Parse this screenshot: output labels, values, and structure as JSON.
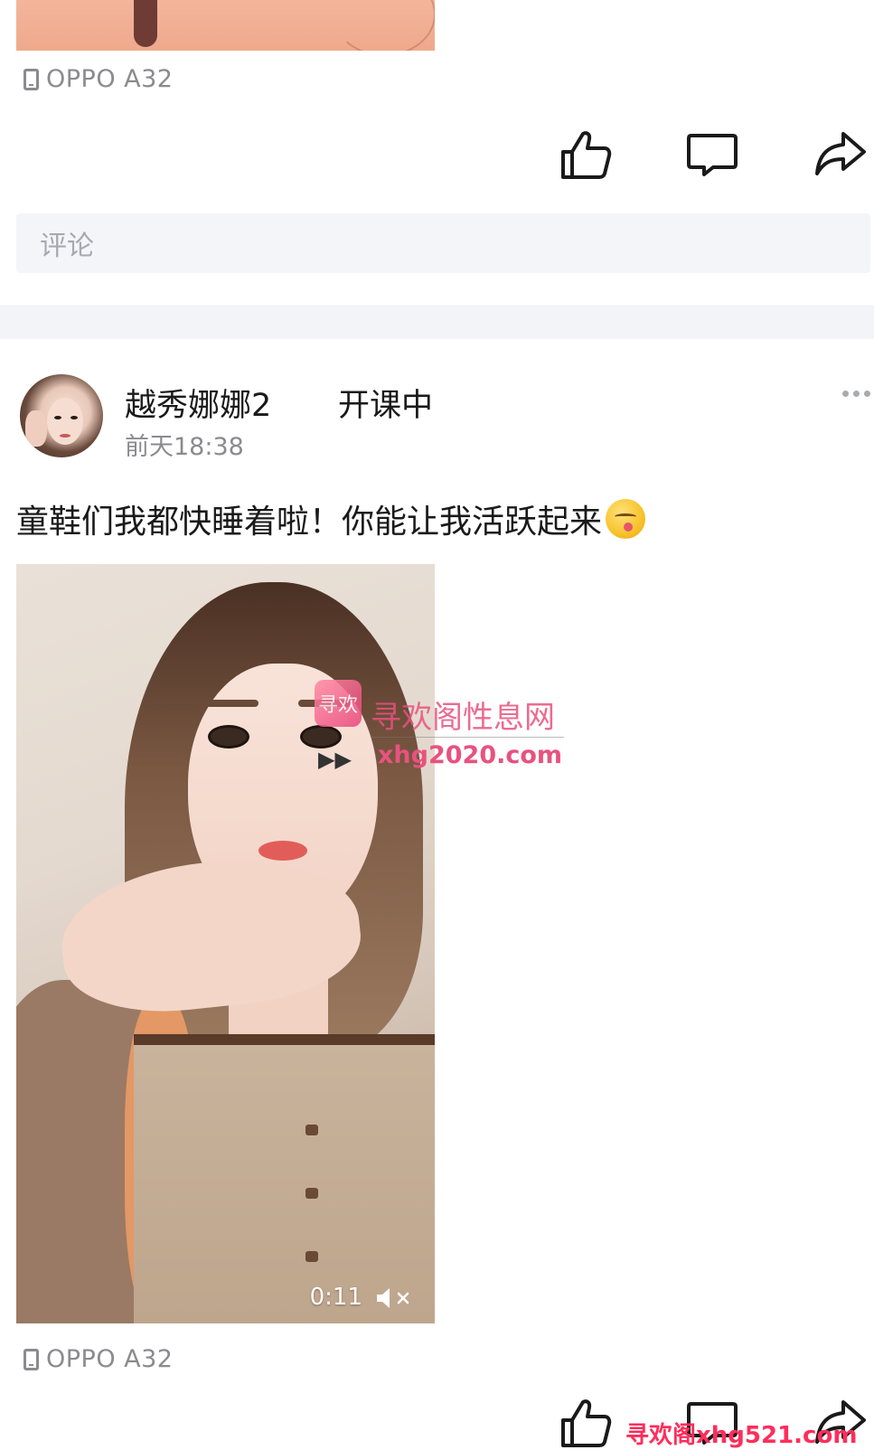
{
  "previous_post": {
    "device": "OPPO A32",
    "comment_placeholder": "评论"
  },
  "post": {
    "username": "越秀娜娜2",
    "tag": "开课中",
    "time": "前天18:38",
    "text": "童鞋们我都快睡着啦！你能让我活跃起来",
    "emoji": "face-savoring-food-icon",
    "video": {
      "duration": "0:11",
      "muted": true
    },
    "device": "OPPO A32"
  },
  "watermark": {
    "logo_text": "寻欢",
    "title": "寻欢阁性息网",
    "arrow": "▶▶",
    "url": "xhg2020.com",
    "bottom_text": "寻欢阁xhg521.com"
  },
  "icons": [
    "like-icon",
    "comment-icon",
    "share-icon",
    "phone-icon",
    "more-icon",
    "mute-icon"
  ]
}
